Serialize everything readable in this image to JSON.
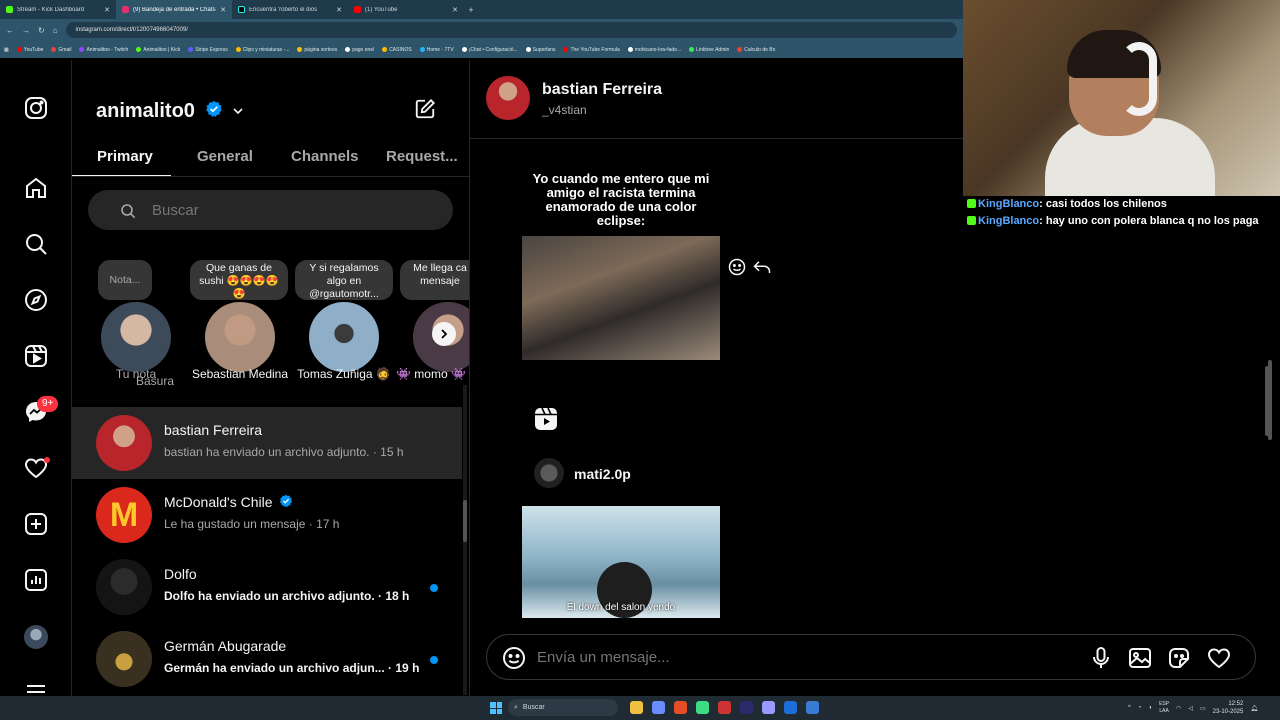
{
  "browser": {
    "tabs": [
      {
        "label": "Stream - Kick Dashboard",
        "color": "#53fc18",
        "active": false
      },
      {
        "label": "(9) Bandeja de entrada • Chats",
        "color": "#e1306c",
        "active": true
      },
      {
        "label": "Encuentra 'roberto el dios",
        "color": "#000000",
        "active": false
      },
      {
        "label": "(1) YouTube",
        "color": "#ff0000",
        "active": false
      }
    ],
    "new_tab": "+",
    "url": "instagram.com/direct/t/120074966047009/",
    "bookmarks": [
      {
        "label": "YouTube",
        "color": "#ff0000"
      },
      {
        "label": "Gmail",
        "color": "#ea4335"
      },
      {
        "label": "Animalitoo - Twitch",
        "color": "#9146ff"
      },
      {
        "label": "Animalitoo | Kick",
        "color": "#53fc18"
      },
      {
        "label": "Stripe Express",
        "color": "#635bff"
      },
      {
        "label": "Clips y miniaturas -...",
        "color": "#fbbc04"
      },
      {
        "label": "página sorteos",
        "color": "#fbbc04"
      },
      {
        "label": "pago enel",
        "color": "#ffffff"
      },
      {
        "label": "CASINOS",
        "color": "#fbbc04"
      },
      {
        "label": "Home - 7TV",
        "color": "#29b6f6"
      },
      {
        "label": "¡Chat • Configuració...",
        "color": "#ffffff"
      },
      {
        "label": "Superfans",
        "color": "#ffffff"
      },
      {
        "label": "The YouTube Formula",
        "color": "#ff0000"
      },
      {
        "label": "mohicano-low-fade...",
        "color": "#ffffff"
      },
      {
        "label": "Linktree Admin",
        "color": "#43e55e"
      },
      {
        "label": "Calculo de Bo",
        "color": "#ea4335"
      }
    ]
  },
  "inbox": {
    "account_name": "animalito0",
    "tabs": [
      "Primary",
      "General",
      "Channels",
      "Request..."
    ],
    "search_placeholder": "Buscar",
    "notes": [
      {
        "note": "Nota...",
        "name": "Tu nota",
        "color": "#3d4a5a"
      },
      {
        "note": "Que ganas de sushi 😍😍😍😍😍",
        "name": "Sebastian Medina",
        "color": "#a98c7a"
      },
      {
        "note": "Y si regalamos algo en @rgautomotr...",
        "name": "Tomas Zuñiga 🧔",
        "color": "#8faec8"
      },
      {
        "note": "Me llega ca mensaje",
        "name": "👾 momo 👾",
        "color": "#4a3a45"
      }
    ],
    "partial_name": "Basura",
    "conversations": [
      {
        "name": "bastian Ferreira",
        "message": "bastian ha enviado un archivo adjunto. · 15 h",
        "unread": false,
        "selected": true,
        "avatar_color": "#b8252a"
      },
      {
        "name": "McDonald's Chile",
        "message": "Le ha gustado un mensaje · 17 h",
        "unread": false,
        "selected": false,
        "avatar_color": "#da291c",
        "verified": true
      },
      {
        "name": "Dolfo",
        "message": "Dolfo ha enviado un archivo adjunto. · 18 h",
        "unread": true,
        "selected": false,
        "avatar_color": "#1a1a1a"
      },
      {
        "name": "Germán Abugarade",
        "message": "Germán ha enviado un archivo adjun... · 19 h",
        "unread": true,
        "selected": false,
        "avatar_color": "#6b5a2a"
      }
    ],
    "notif_count": "9+"
  },
  "chat": {
    "name": "bastian Ferreira",
    "username": "_v4stian",
    "meme_caption": "Yo cuando me entero que mi amigo el racista termina enamorado de una color eclipse:",
    "sender": "mati2.0p",
    "reel_subtitle": "El down del salon yendo",
    "composer_placeholder": "Envía un mensaje..."
  },
  "stream_chat": [
    {
      "user": "KingBlanco",
      "text": ": casi todos los chilenos"
    },
    {
      "user": "KingBlanco",
      "text": ": hay uno con polera blanca q no los paga"
    }
  ],
  "taskbar": {
    "search": "Buscar",
    "lang_top": "ESP",
    "lang_bottom": "LAA",
    "time": "12:52",
    "date": "23-10-2025",
    "apps": [
      "#f0c040",
      "#6a8cff",
      "#e44d26",
      "#3ddc84",
      "#cc3333",
      "#2b2b6b",
      "#9999ff",
      "#1d6ed8",
      "#3a7bd5"
    ]
  },
  "colors": {
    "accent": "#0095f6",
    "badge": "#ff3040",
    "verified": "#0095f6"
  }
}
